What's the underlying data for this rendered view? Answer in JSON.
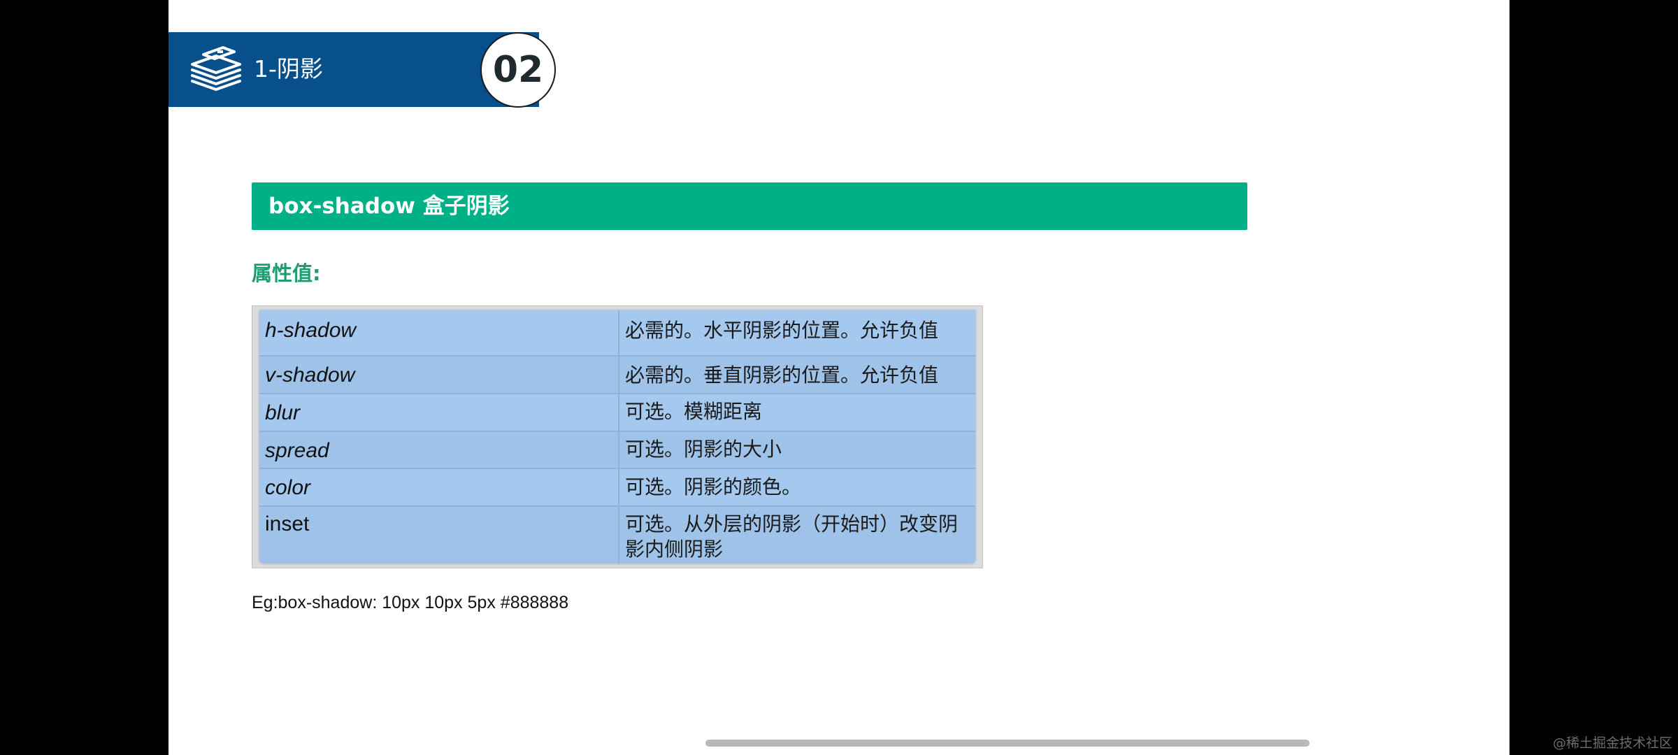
{
  "header": {
    "title": "1-阴影",
    "number": "02",
    "band_color": "#07508c",
    "icon": "books-icon"
  },
  "section": {
    "title": "box-shadow 盒子阴影",
    "bar_color": "#00b086"
  },
  "attributes_label": "属性值:",
  "table": {
    "rows": [
      {
        "name": "h-shadow",
        "desc": "必需的。水平阴影的位置。允许负值"
      },
      {
        "name": "v-shadow",
        "desc": "必需的。垂直阴影的位置。允许负值"
      },
      {
        "name": "blur",
        "desc": "可选。模糊距离"
      },
      {
        "name": "spread",
        "desc": "可选。阴影的大小"
      },
      {
        "name": "color",
        "desc": "可选。阴影的颜色。"
      },
      {
        "name": "inset",
        "desc": "可选。从外层的阴影（开始时）改变阴影内侧阴影"
      }
    ]
  },
  "example": "Eg:box-shadow: 10px 10px 5px #888888",
  "watermark": "@稀土掘金技术社区"
}
